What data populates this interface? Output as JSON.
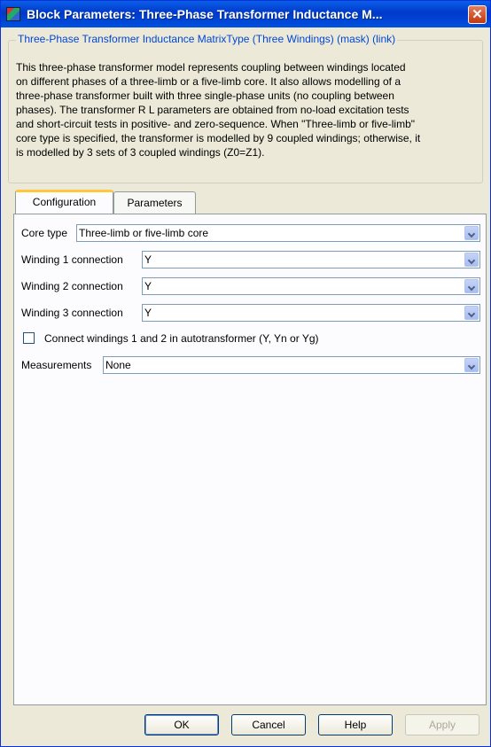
{
  "window": {
    "title": "Block Parameters: Three-Phase Transformer Inductance M..."
  },
  "mask": {
    "legend": "Three-Phase Transformer Inductance MatrixType (Three Windings) (mask) (link)",
    "description": "This three-phase transformer model represents coupling between windings located\non different phases of a three-limb or a five-limb core.  It also allows modelling of a\nthree-phase transformer built with three single-phase units (no coupling between\nphases). The transformer R L parameters are obtained from no-load excitation tests\nand short-circuit tests in positive- and zero-sequence. When \"Three-limb or five-limb\"\ncore type is specified, the transformer is modelled by 9 coupled windings; otherwise, it\nis modelled by 3 sets of 3 coupled windings (Z0=Z1)."
  },
  "tabs": [
    {
      "label": "Configuration",
      "active": true
    },
    {
      "label": "Parameters",
      "active": false
    }
  ],
  "configuration": {
    "core_type": {
      "label": "Core type",
      "value": "Three-limb or five-limb core"
    },
    "winding1": {
      "label": "Winding 1 connection",
      "value": "Y"
    },
    "winding2": {
      "label": "Winding 2 connection",
      "value": "Y"
    },
    "winding3": {
      "label": "Winding 3 connection",
      "value": "Y"
    },
    "autotransformer": {
      "label": "Connect windings 1 and 2  in autotransformer  (Y, Yn or Yg)",
      "checked": false
    },
    "measurements": {
      "label": "Measurements",
      "value": "None"
    }
  },
  "buttons": {
    "ok": "OK",
    "cancel": "Cancel",
    "help": "Help",
    "apply": "Apply"
  },
  "colors": {
    "titlebar": "#0a5ee8",
    "tab_highlight": "#ffc83c",
    "legend": "#0046d5"
  }
}
